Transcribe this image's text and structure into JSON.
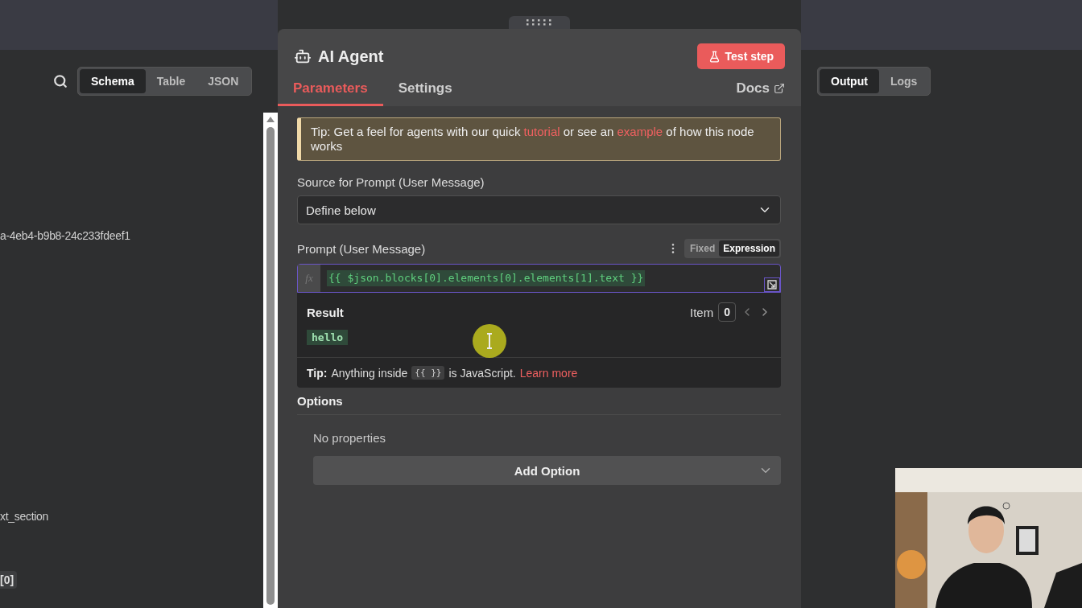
{
  "input_panel": {
    "view_tabs": [
      {
        "label": "Schema",
        "selected": true
      },
      {
        "label": "Table",
        "selected": false
      },
      {
        "label": "JSON",
        "selected": false
      }
    ],
    "lines": [
      {
        "kind": "text",
        "text": "a-4eb4-b9b8-24c233fdeef1"
      },
      {
        "kind": "text",
        "text": "xt_section"
      },
      {
        "kind": "tag",
        "text": "[0]"
      }
    ]
  },
  "node": {
    "title": "AI Agent",
    "test_button": "Test step",
    "tabs": [
      {
        "label": "Parameters",
        "selected": true
      },
      {
        "label": "Settings",
        "selected": false
      }
    ],
    "docs_link": "Docs",
    "tip": {
      "parts": [
        {
          "kind": "text",
          "text": "Tip: Get a feel for agents with our quick "
        },
        {
          "kind": "link",
          "text": "tutorial"
        },
        {
          "kind": "text",
          "text": " or see an "
        },
        {
          "kind": "link",
          "text": "example"
        },
        {
          "kind": "text",
          "text": " of how this node works"
        }
      ]
    },
    "source_label": "Source for Prompt (User Message)",
    "source_value": "Define below",
    "prompt_label": "Prompt (User Message)",
    "mode_toggle": [
      {
        "label": "Fixed",
        "selected": false
      },
      {
        "label": "Expression",
        "selected": true
      }
    ],
    "fx": "fx",
    "expression": "{{ $json.blocks[0].elements[0].elements[1].text }}",
    "result": {
      "label": "Result",
      "item_label": "Item",
      "item_index": "0",
      "value": "hello"
    },
    "hint": {
      "bold": "Tip:",
      "before": "Anything inside",
      "code": "{{ }}",
      "after": "is JavaScript.",
      "link": "Learn more"
    },
    "options_label": "Options",
    "no_properties": "No properties",
    "add_option": "Add Option"
  },
  "output_panel": {
    "tabs": [
      {
        "label": "Output",
        "selected": true
      },
      {
        "label": "Logs",
        "selected": false
      }
    ]
  }
}
